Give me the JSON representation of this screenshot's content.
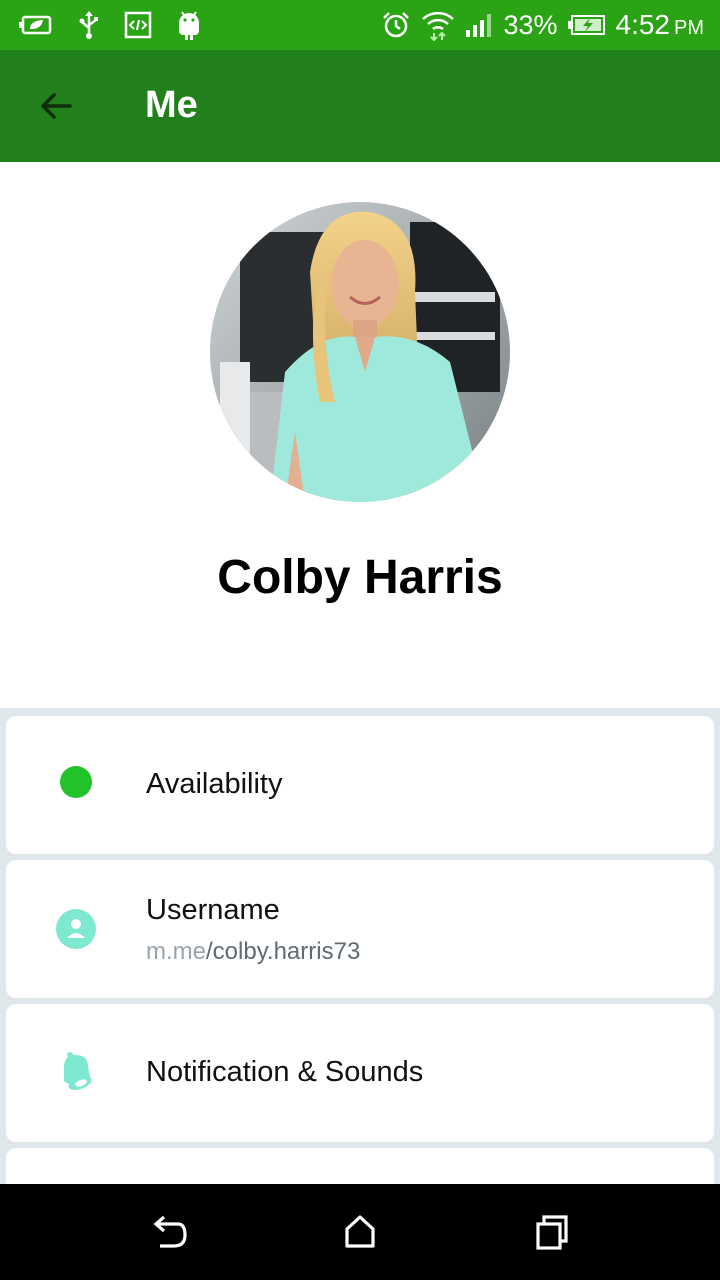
{
  "status_bar": {
    "battery_percent": "33%",
    "time": "4:52",
    "time_suffix": "PM",
    "left_icons": [
      "battery-saver-icon",
      "usb-icon",
      "developer-mode-icon",
      "android-icon"
    ],
    "right_icons": [
      "alarm-icon",
      "wifi-icon",
      "signal-icon",
      "battery-charging-icon"
    ]
  },
  "app_bar": {
    "title": "Me",
    "back_icon": "arrow-left-icon"
  },
  "profile": {
    "name": "Colby Harris",
    "avatar_icon": "profile-photo"
  },
  "settings": {
    "items": [
      {
        "label": "Availability",
        "icon": "green-dot-icon"
      },
      {
        "label": "Username",
        "sub_prefix": "m.me",
        "sub_value": "/colby.harris73",
        "icon": "person-icon"
      },
      {
        "label": "Notification & Sounds",
        "icon": "bell-icon"
      }
    ]
  },
  "nav_bar": {
    "buttons": [
      "back-icon",
      "home-icon",
      "recents-icon"
    ]
  },
  "colors": {
    "status_bar": "#2aa314",
    "app_bar": "#21801b",
    "availability": "#22c22a",
    "accent_icon": "#7ee8d0",
    "settings_bg": "#dfe7ea"
  }
}
